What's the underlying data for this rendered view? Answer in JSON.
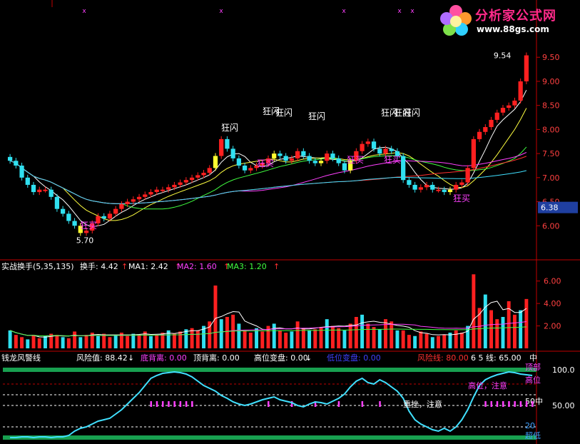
{
  "chart_data": [
    {
      "type": "candlestick",
      "name_panel": "price",
      "ylim": [
        5.5,
        9.8
      ],
      "yticks": [
        "9.50",
        "9.00",
        "8.50",
        "8.00",
        "7.50",
        "7.00",
        "6.50",
        "6.00"
      ],
      "last_price_tag": "6.38",
      "high_label": "9.54",
      "low_label": "5.70",
      "annotations": [
        "狂闪",
        "狂闪",
        "狂闪",
        "狂闪",
        "狂闪",
        "狂闪",
        "狂闪",
        "狂买",
        "狂买",
        "狂买",
        "狂买",
        "狂买"
      ],
      "candles_close": [
        7.35,
        7.25,
        7.0,
        6.85,
        6.7,
        6.75,
        6.75,
        6.6,
        6.35,
        6.25,
        6.1,
        6.0,
        5.85,
        5.9,
        6.05,
        6.2,
        6.15,
        6.25,
        6.35,
        6.45,
        6.5,
        6.55,
        6.6,
        6.65,
        6.7,
        6.75,
        6.75,
        6.8,
        6.85,
        6.9,
        6.95,
        7.0,
        7.05,
        7.1,
        7.2,
        7.45,
        7.8,
        7.6,
        7.4,
        7.25,
        7.15,
        7.2,
        7.25,
        7.3,
        7.4,
        7.5,
        7.45,
        7.35,
        7.4,
        7.55,
        7.45,
        7.35,
        7.3,
        7.35,
        7.5,
        7.4,
        7.3,
        7.15,
        7.35,
        7.55,
        7.7,
        7.75,
        7.6,
        7.5,
        7.6,
        7.55,
        7.45,
        6.95,
        6.85,
        6.75,
        6.8,
        6.85,
        6.75,
        6.75,
        6.7,
        6.75,
        6.85,
        6.9,
        7.2,
        7.8,
        7.95,
        8.05,
        8.2,
        8.35,
        8.45,
        8.5,
        8.6,
        9.0,
        9.54
      ]
    },
    {
      "type": "bar",
      "name_panel": "volume",
      "title": "实战换手(5,35,135)",
      "items": [
        {
          "label": "换手: 4.42",
          "arrow": "↑"
        },
        {
          "label": "MA1: 2.42",
          "arrow": "↑"
        },
        {
          "label": "MA2: 1.60",
          "arrow": "↑"
        },
        {
          "label": "MA3: 1.20",
          "arrow": "↑"
        }
      ],
      "ylim": [
        0,
        7
      ],
      "yticks": [
        "6.00",
        "4.00",
        "2.00"
      ],
      "values": [
        1.6,
        1.2,
        1.0,
        0.8,
        1.2,
        0.9,
        1.1,
        1.3,
        1.2,
        1.0,
        0.9,
        1.5,
        1.0,
        1.2,
        1.4,
        1.1,
        1.3,
        1.0,
        1.2,
        1.4,
        1.1,
        1.3,
        1.2,
        1.5,
        1.1,
        1.2,
        1.4,
        1.6,
        1.3,
        1.5,
        1.7,
        1.8,
        1.6,
        2.0,
        2.4,
        5.6,
        2.6,
        2.8,
        3.0,
        2.2,
        1.6,
        1.4,
        1.8,
        1.5,
        2.0,
        2.2,
        1.6,
        1.4,
        1.5,
        2.4,
        1.8,
        1.6,
        1.7,
        1.9,
        2.6,
        2.0,
        1.8,
        1.6,
        2.2,
        2.8,
        3.0,
        2.2,
        1.9,
        1.7,
        2.6,
        2.4,
        1.6,
        1.6,
        1.2,
        1.1,
        1.5,
        1.3,
        1.0,
        1.1,
        1.2,
        1.4,
        1.6,
        1.4,
        2.0,
        6.6,
        3.6,
        4.8,
        3.4,
        2.6,
        2.8,
        4.2,
        3.0,
        3.4,
        4.4
      ]
    },
    {
      "type": "line",
      "name_panel": "indicator",
      "title": "钱龙风警线",
      "items": [
        {
          "label": "风险值: 88.42",
          "arrow": "↓"
        },
        {
          "label": "底背离: 0.00",
          "arrow": ""
        },
        {
          "label": "顶背离: 0.00",
          "arrow": ""
        },
        {
          "label": "高位变盘: 0.00",
          "arrow": "↓"
        },
        {
          "label": "低位变盘: 0.00",
          "arrow": ""
        },
        {
          "label": "风险线: 80.00",
          "arrow": ""
        },
        {
          "label": "6 5 线: 65.00",
          "arrow": ""
        },
        {
          "label": "中",
          "arrow": ""
        }
      ],
      "ylim": [
        0,
        110
      ],
      "yticks": [
        "100.0",
        "50.00"
      ],
      "side_labels": [
        "顶部",
        "高位",
        "50中",
        "20",
        "超低"
      ],
      "notes": [
        "高位，注意",
        "重挫，注意"
      ],
      "values": [
        5,
        5,
        6,
        6,
        5,
        6,
        6,
        5,
        6,
        6,
        8,
        14,
        18,
        20,
        24,
        28,
        30,
        32,
        38,
        44,
        52,
        60,
        68,
        78,
        88,
        92,
        95,
        96,
        97,
        96,
        94,
        90,
        84,
        78,
        74,
        70,
        64,
        60,
        55,
        52,
        50,
        52,
        55,
        58,
        60,
        62,
        58,
        56,
        54,
        50,
        48,
        52,
        55,
        54,
        52,
        56,
        60,
        66,
        76,
        84,
        88,
        82,
        80,
        86,
        82,
        76,
        70,
        60,
        42,
        30,
        24,
        20,
        16,
        14,
        18,
        14,
        20,
        30,
        44,
        62,
        78,
        86,
        90,
        93,
        95,
        97,
        96,
        94,
        93,
        92
      ]
    }
  ],
  "colors": {
    "up": "#ff2020",
    "down": "#30e0f0",
    "ma1": "#ffffff",
    "ma2": "#ff40ff",
    "ma3": "#40ff40",
    "frame": "#c00000"
  },
  "logo": {
    "title": "分析家公式网",
    "url": "www.88gs.com"
  }
}
